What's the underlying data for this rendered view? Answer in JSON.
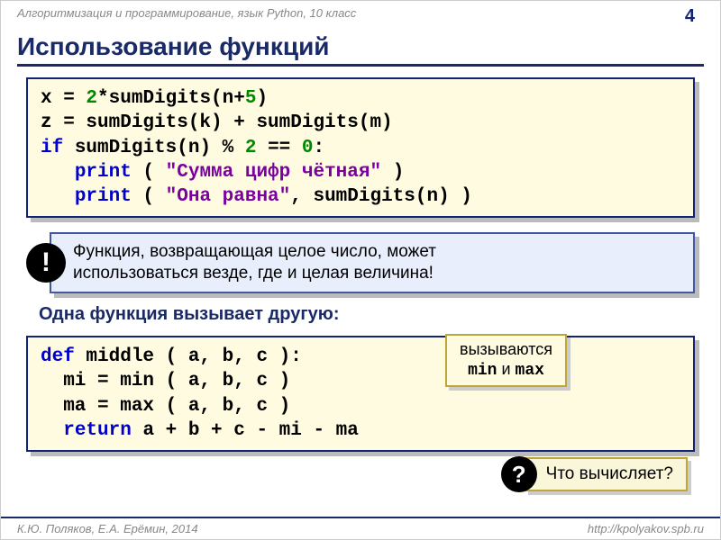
{
  "header": {
    "course": "Алгоритмизация и программирование, язык Python, 10 класс",
    "page": "4"
  },
  "title": "Использование функций",
  "code1": {
    "l1a": "x = ",
    "l1b": "2",
    "l1c": "*sumDigits(n+",
    "l1d": "5",
    "l1e": ")",
    "l2a": "z = sumDigits(k) + sumDigits(m)",
    "l3a": "if",
    "l3b": " sumDigits(n)",
    "l3c": " % ",
    "l3d": "2",
    "l3e": " == ",
    "l3f": "0",
    "l3g": ":",
    "l4a": "   ",
    "l4b": "print",
    "l4c": " ( ",
    "l4d": "\"Сумма цифр чётная\"",
    "l4e": " )",
    "l5a": "   ",
    "l5b": "print",
    "l5c": " ( ",
    "l5d": "\"Она равна\"",
    "l5e": ", sumDigits(n) )"
  },
  "note": {
    "bang": "!",
    "text_l1": "Функция, возвращающая целое число, может",
    "text_l2": "использоваться везде, где и целая величина!"
  },
  "subhead": "Одна функция вызывает другую:",
  "code2": {
    "l1a": "def",
    "l1b": " middle ( a, b, c ):",
    "l2a": "  mi = min ( a, b, c )",
    "l3a": "  ma = max ( a, b, c )",
    "l4a": "  ",
    "l4b": "return",
    "l4c": " a + b + c - mi - ma"
  },
  "callout": {
    "l1": "вызываются",
    "l2a": "min",
    "l2b": " и ",
    "l2c": "max"
  },
  "question": {
    "mark": "?",
    "text": "Что вычисляет?"
  },
  "footer": {
    "left": "К.Ю. Поляков, Е.А. Ерёмин, 2014",
    "right": "http://kpolyakov.spb.ru"
  }
}
